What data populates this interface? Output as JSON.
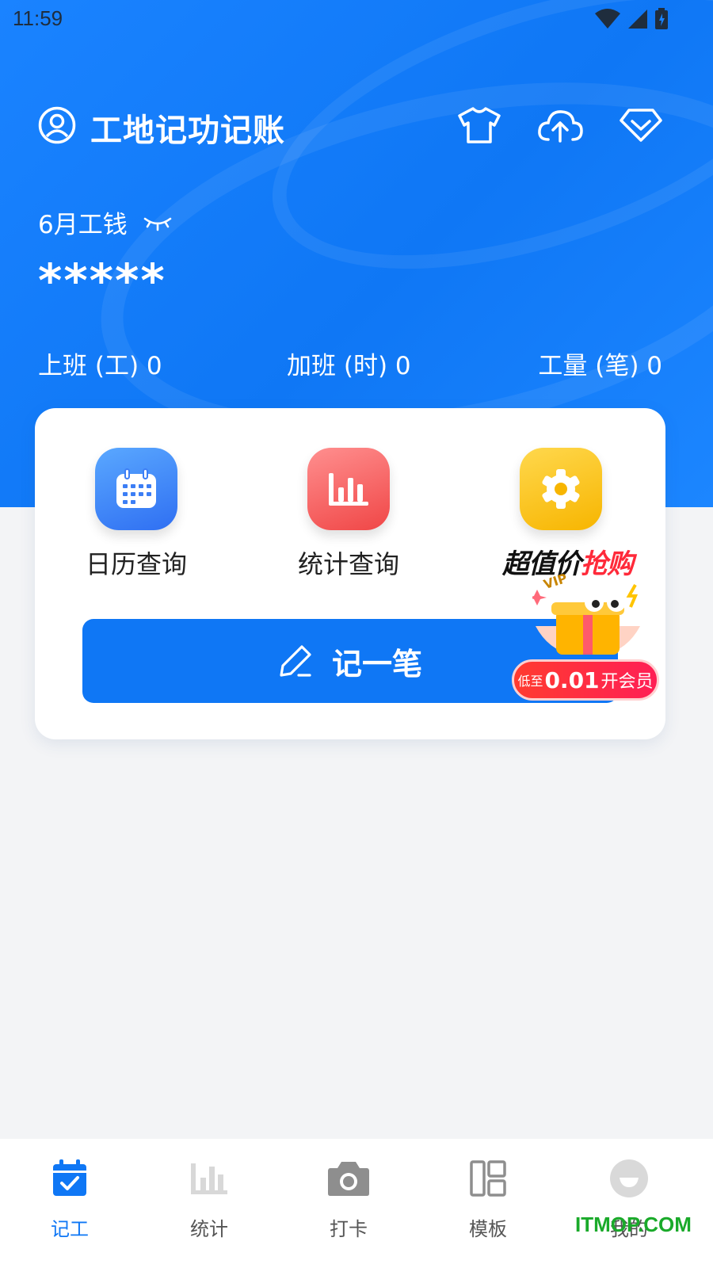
{
  "status_bar": {
    "time": "11:59"
  },
  "app": {
    "title": "工地记功记账"
  },
  "summary": {
    "wage_label": "6月工钱",
    "wage_value": "*****",
    "stats": [
      {
        "label": "上班 (工) 0"
      },
      {
        "label": "加班 (时) 0"
      },
      {
        "label": "工量 (笔) 0"
      }
    ]
  },
  "quick_actions": [
    {
      "label": "日历查询",
      "icon": "calendar-icon",
      "color": "#2f6ff2"
    },
    {
      "label": "统计查询",
      "icon": "bar-chart-icon",
      "color": "#f04646"
    },
    {
      "label": "",
      "icon": "gear-icon",
      "color": "#f7b500"
    }
  ],
  "record_button": {
    "label": "记一笔"
  },
  "promo": {
    "title_part1": "超值价",
    "title_part2": "抢购",
    "badge": "VIP",
    "button_prefix": "低至",
    "button_price": "0.01",
    "button_suffix": "开会员"
  },
  "tabs": [
    {
      "label": "记工",
      "active": true
    },
    {
      "label": "统计",
      "active": false
    },
    {
      "label": "打卡",
      "active": false
    },
    {
      "label": "模板",
      "active": false
    },
    {
      "label": "我的",
      "active": false
    }
  ],
  "watermark": "ITMOP.COM",
  "colors": {
    "primary": "#0f77f5",
    "background": "#f3f4f6",
    "promo_red": "#ff2a3a"
  }
}
